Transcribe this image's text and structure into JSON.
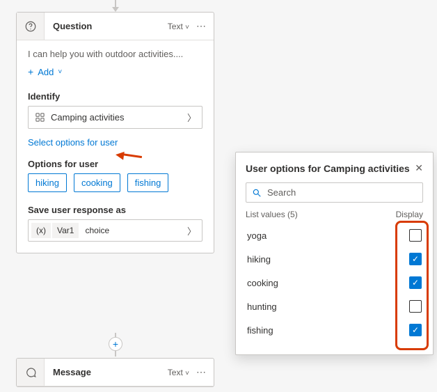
{
  "question": {
    "title": "Question",
    "type_label": "Text",
    "message": "I can help you with outdoor activities....",
    "add_label": "Add",
    "identify_label": "Identify",
    "identify_value": "Camping activities",
    "select_options_link": "Select options for user",
    "options_label": "Options for user",
    "options": [
      "hiking",
      "cooking",
      "fishing"
    ],
    "save_as_label": "Save user response as",
    "var_icon": "(x)",
    "var_name": "Var1",
    "var_type": "choice"
  },
  "message": {
    "title": "Message",
    "type_label": "Text"
  },
  "panel": {
    "title": "User options for Camping activities",
    "search_placeholder": "Search",
    "list_label": "List values (5)",
    "display_label": "Display",
    "items": [
      {
        "label": "yoga",
        "checked": false
      },
      {
        "label": "hiking",
        "checked": true
      },
      {
        "label": "cooking",
        "checked": true
      },
      {
        "label": "hunting",
        "checked": false
      },
      {
        "label": "fishing",
        "checked": true
      }
    ]
  }
}
